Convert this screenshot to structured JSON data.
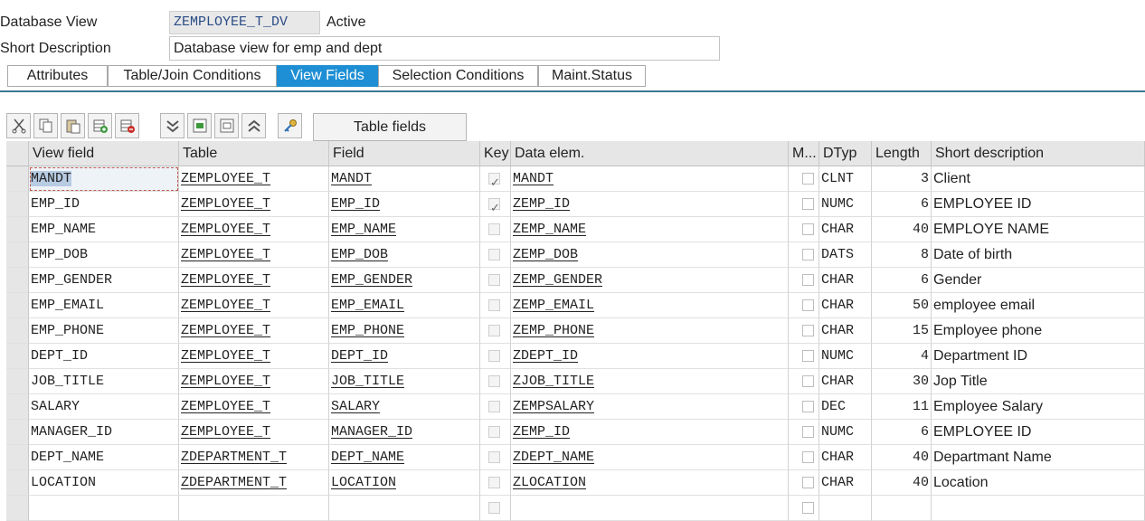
{
  "header": {
    "db_view_label": "Database View",
    "view_name": "ZEMPLOYEE_T_DV",
    "status": "Active",
    "short_desc_label": "Short Description",
    "short_desc_value": "Database view for emp and dept"
  },
  "tabs": [
    {
      "label": "Attributes",
      "active": false
    },
    {
      "label": "Table/Join Conditions",
      "active": false
    },
    {
      "label": "View Fields",
      "active": true
    },
    {
      "label": "Selection Conditions",
      "active": false
    },
    {
      "label": "Maint.Status",
      "active": false
    }
  ],
  "toolbar": {
    "icons": [
      "cut-icon",
      "copy-icon",
      "paste-icon",
      "insert-row-icon",
      "delete-row-icon",
      "expand-all-icon",
      "select-block-icon",
      "deselect-block-icon",
      "collapse-all-icon",
      "key-icon"
    ],
    "table_fields_label": "Table fields"
  },
  "grid": {
    "columns": [
      "View field",
      "Table",
      "Field",
      "Key",
      "Data elem.",
      "M...",
      "DTyp",
      "Length",
      "Short description"
    ],
    "rows": [
      {
        "view_field": "MANDT",
        "table": "ZEMPLOYEE_T",
        "field": "MANDT",
        "key": true,
        "data_elem": "MANDT",
        "m": false,
        "dtyp": "CLNT",
        "length": "3",
        "short_desc": "Client"
      },
      {
        "view_field": "EMP_ID",
        "table": "ZEMPLOYEE_T",
        "field": "EMP_ID",
        "key": true,
        "data_elem": "ZEMP_ID",
        "m": false,
        "dtyp": "NUMC",
        "length": "6",
        "short_desc": "EMPLOYEE ID"
      },
      {
        "view_field": "EMP_NAME",
        "table": "ZEMPLOYEE_T",
        "field": "EMP_NAME",
        "key": false,
        "data_elem": "ZEMP_NAME",
        "m": false,
        "dtyp": "CHAR",
        "length": "40",
        "short_desc": "EMPLOYE NAME"
      },
      {
        "view_field": "EMP_DOB",
        "table": "ZEMPLOYEE_T",
        "field": "EMP_DOB",
        "key": false,
        "data_elem": "ZEMP_DOB",
        "m": false,
        "dtyp": "DATS",
        "length": "8",
        "short_desc": "Date of birth"
      },
      {
        "view_field": "EMP_GENDER",
        "table": "ZEMPLOYEE_T",
        "field": "EMP_GENDER",
        "key": false,
        "data_elem": "ZEMP_GENDER",
        "m": false,
        "dtyp": "CHAR",
        "length": "6",
        "short_desc": "Gender"
      },
      {
        "view_field": "EMP_EMAIL",
        "table": "ZEMPLOYEE_T",
        "field": "EMP_EMAIL",
        "key": false,
        "data_elem": "ZEMP_EMAIL",
        "m": false,
        "dtyp": "CHAR",
        "length": "50",
        "short_desc": "employee email"
      },
      {
        "view_field": "EMP_PHONE",
        "table": "ZEMPLOYEE_T",
        "field": "EMP_PHONE",
        "key": false,
        "data_elem": "ZEMP_PHONE",
        "m": false,
        "dtyp": "CHAR",
        "length": "15",
        "short_desc": "Employee phone"
      },
      {
        "view_field": "DEPT_ID",
        "table": "ZEMPLOYEE_T",
        "field": "DEPT_ID",
        "key": false,
        "data_elem": "ZDEPT_ID",
        "m": false,
        "dtyp": "NUMC",
        "length": "4",
        "short_desc": "Department ID"
      },
      {
        "view_field": "JOB_TITLE",
        "table": "ZEMPLOYEE_T",
        "field": "JOB_TITLE",
        "key": false,
        "data_elem": "ZJOB_TITLE",
        "m": false,
        "dtyp": "CHAR",
        "length": "30",
        "short_desc": "Jop Title"
      },
      {
        "view_field": "SALARY",
        "table": "ZEMPLOYEE_T",
        "field": "SALARY",
        "key": false,
        "data_elem": "ZEMPSALARY",
        "m": false,
        "dtyp": "DEC",
        "length": "11",
        "short_desc": "Employee Salary"
      },
      {
        "view_field": "MANAGER_ID",
        "table": "ZEMPLOYEE_T",
        "field": "MANAGER_ID",
        "key": false,
        "data_elem": "ZEMP_ID",
        "m": false,
        "dtyp": "NUMC",
        "length": "6",
        "short_desc": "EMPLOYEE ID"
      },
      {
        "view_field": "DEPT_NAME",
        "table": "ZDEPARTMENT_T",
        "field": "DEPT_NAME",
        "key": false,
        "data_elem": "ZDEPT_NAME",
        "m": false,
        "dtyp": "CHAR",
        "length": "40",
        "short_desc": "Departmant Name"
      },
      {
        "view_field": "LOCATION",
        "table": "ZDEPARTMENT_T",
        "field": "LOCATION",
        "key": false,
        "data_elem": "ZLOCATION",
        "m": false,
        "dtyp": "CHAR",
        "length": "40",
        "short_desc": "Location"
      },
      {
        "view_field": "",
        "table": "",
        "field": "",
        "key": false,
        "data_elem": "",
        "m": false,
        "dtyp": "",
        "length": "",
        "short_desc": ""
      }
    ]
  }
}
